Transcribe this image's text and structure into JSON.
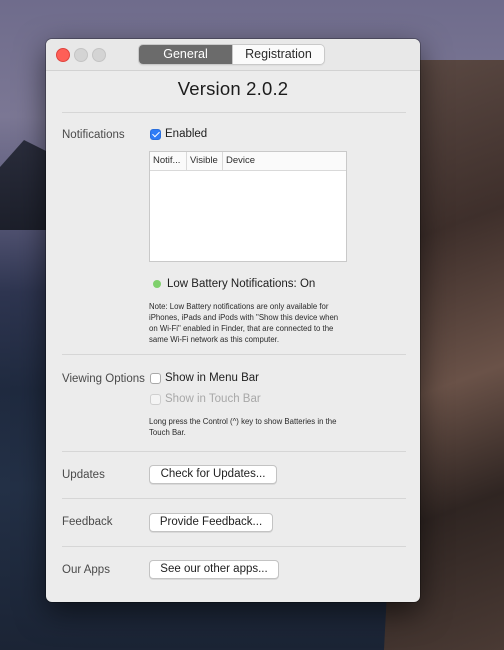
{
  "tabs": {
    "general": "General",
    "registration": "Registration"
  },
  "version": "Version 2.0.2",
  "notifications": {
    "label": "Notifications",
    "enabled_label": "Enabled",
    "enabled_checked": true,
    "table_headers": [
      "Notif...",
      "Visible",
      "Device"
    ],
    "status_text": "Low Battery Notifications: On",
    "status_color": "#7fd06c",
    "note_lines": [
      "Note: Low Battery notifications are only available for",
      "iPhones, iPads and iPods with \"Show this device when",
      "on Wi-Fi\" enabled in Finder, that are connected to the",
      "same Wi-Fi network as this computer."
    ]
  },
  "viewing": {
    "label": "Viewing Options",
    "menu_bar_label": "Show in Menu Bar",
    "menu_bar_checked": false,
    "touch_bar_label": "Show in Touch Bar",
    "touch_bar_enabled": false,
    "note_lines": [
      "Long press the Control (^) key to show Batteries in the",
      "Touch Bar."
    ]
  },
  "updates": {
    "label": "Updates",
    "button": "Check for Updates..."
  },
  "feedback": {
    "label": "Feedback",
    "button": "Provide Feedback..."
  },
  "apps": {
    "label": "Our Apps",
    "button": "See our other apps..."
  }
}
